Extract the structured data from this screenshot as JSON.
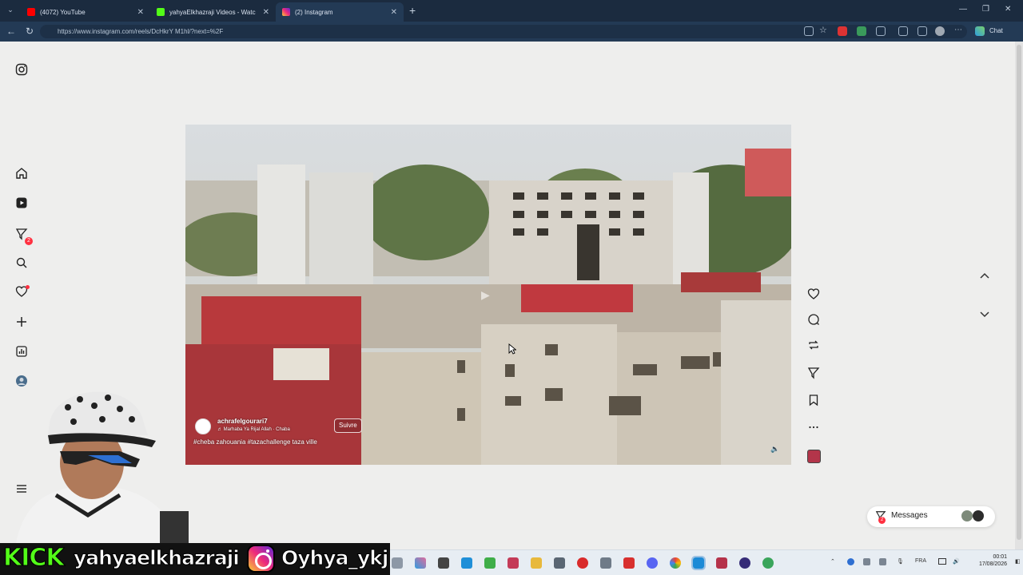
{
  "browser": {
    "tabs": [
      {
        "title": "(4072) YouTube",
        "favicon": "youtube-icon",
        "color": "#ff0000"
      },
      {
        "title": "yahyaElkhazraji Videos - Watc",
        "favicon": "kick-icon",
        "color": "#53fc18"
      },
      {
        "title": "(2) Instagram",
        "favicon": "instagram-icon",
        "color": "#e1306c"
      }
    ],
    "url": "https://www.instagram.com/reels/DcHkrY M1hl/?next=%2F",
    "chat_label": "Chat"
  },
  "sidebar": {
    "items": [
      {
        "name": "instagram-icon"
      },
      {
        "name": "home-icon"
      },
      {
        "name": "reels-icon"
      },
      {
        "name": "messages-icon",
        "badge": "2"
      },
      {
        "name": "search-icon"
      },
      {
        "name": "notifications-icon"
      },
      {
        "name": "create-icon"
      },
      {
        "name": "dashboard-icon"
      },
      {
        "name": "profile-avatar"
      },
      {
        "name": "more-menu-icon"
      }
    ]
  },
  "reel": {
    "username": "achrafelgourari7",
    "music": "Marhaba Ya Rijal Allah · Chaba",
    "follow_label": "Suivre",
    "caption": "#cheba zahouania #tazachallenge taza ville",
    "actions": [
      "like-icon",
      "comment-icon",
      "repost-icon",
      "share-icon",
      "save-icon",
      "more-icon"
    ]
  },
  "messages": {
    "label": "Messages",
    "badge": "2"
  },
  "overlay": {
    "kick_brand": "KICK",
    "kick_handle": "yahyaelkhazraji",
    "ig_handle": "Oyhya_ykj"
  },
  "taskbar": {
    "language": "FRA",
    "time": "00:01",
    "date": "17/08/2026"
  },
  "colors": {
    "tabbar": "#1b2b3f",
    "addrbar": "#233a55",
    "page_bg": "#eeeeed",
    "notification_red": "#ff3040",
    "kick_green": "#53fc18"
  }
}
